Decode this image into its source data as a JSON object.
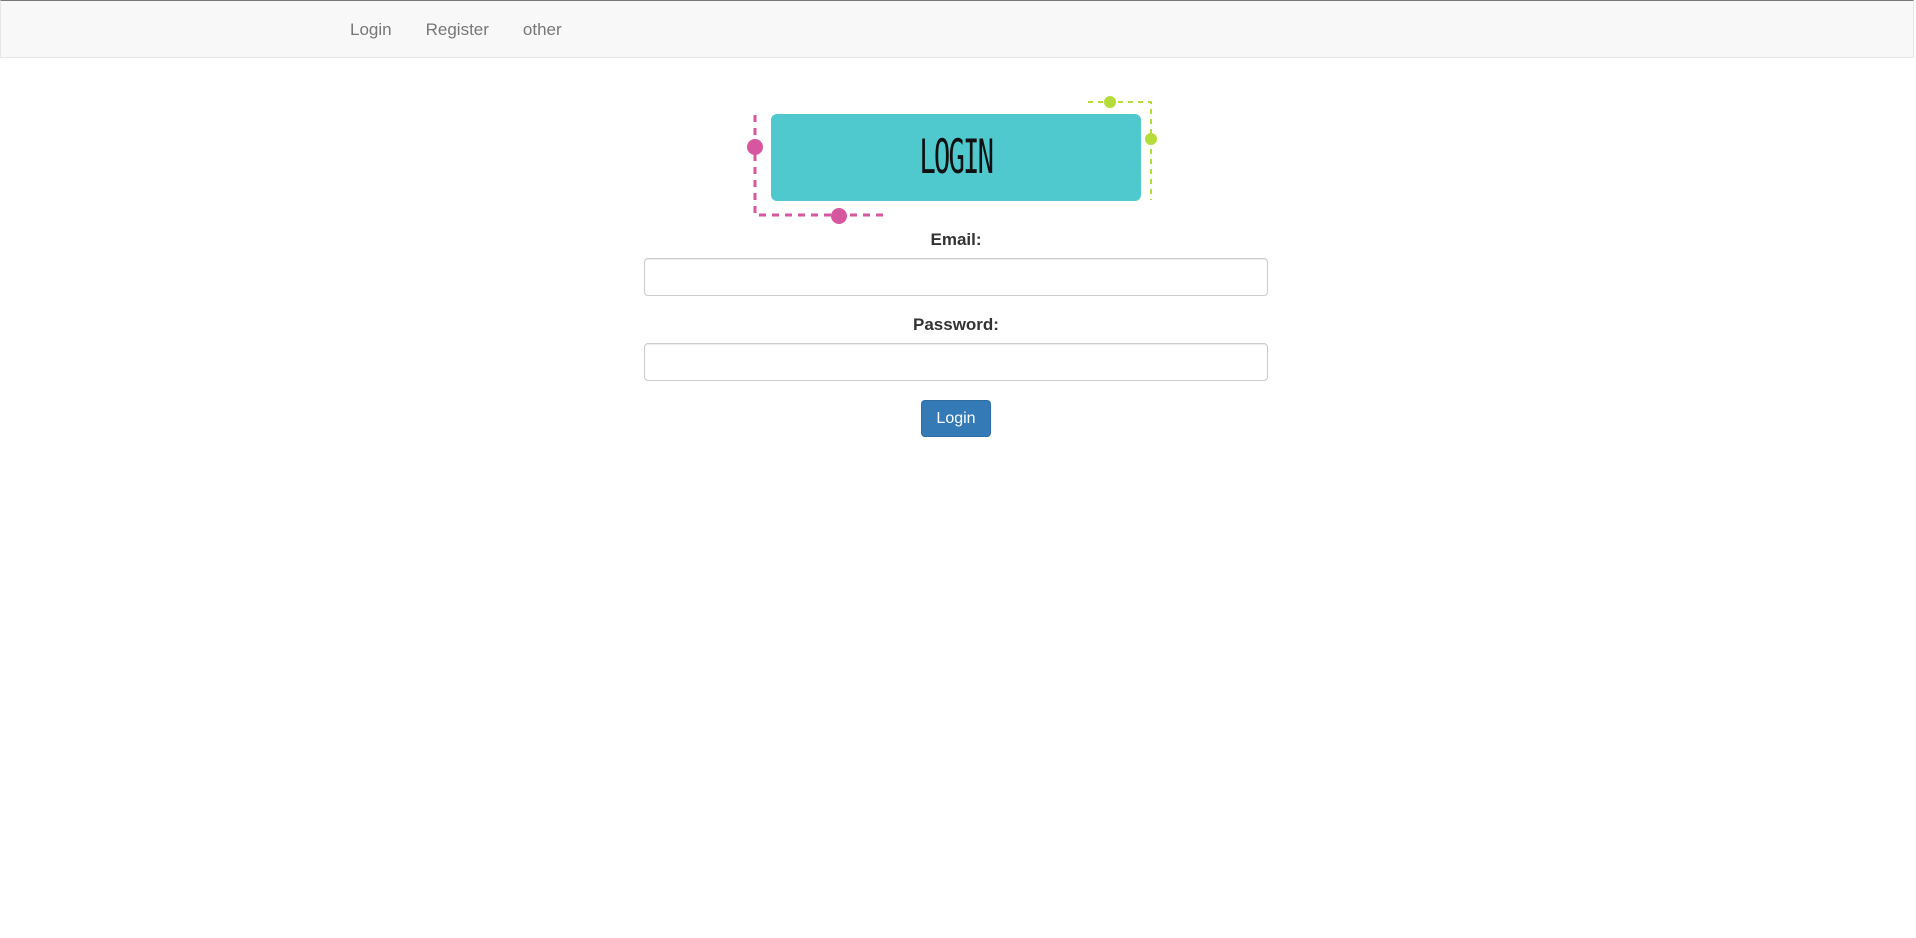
{
  "navbar": {
    "items": [
      {
        "label": "Login"
      },
      {
        "label": "Register"
      },
      {
        "label": "other"
      }
    ]
  },
  "banner": {
    "text": "LOGIN",
    "background_color": "#4fc9cd",
    "accent_colors": [
      "#d6579f",
      "#b6dc3c"
    ]
  },
  "form": {
    "email_label": "Email:",
    "email_value": "",
    "password_label": "Password:",
    "password_value": "",
    "submit_label": "Login",
    "submit_color": "#337ab7"
  }
}
